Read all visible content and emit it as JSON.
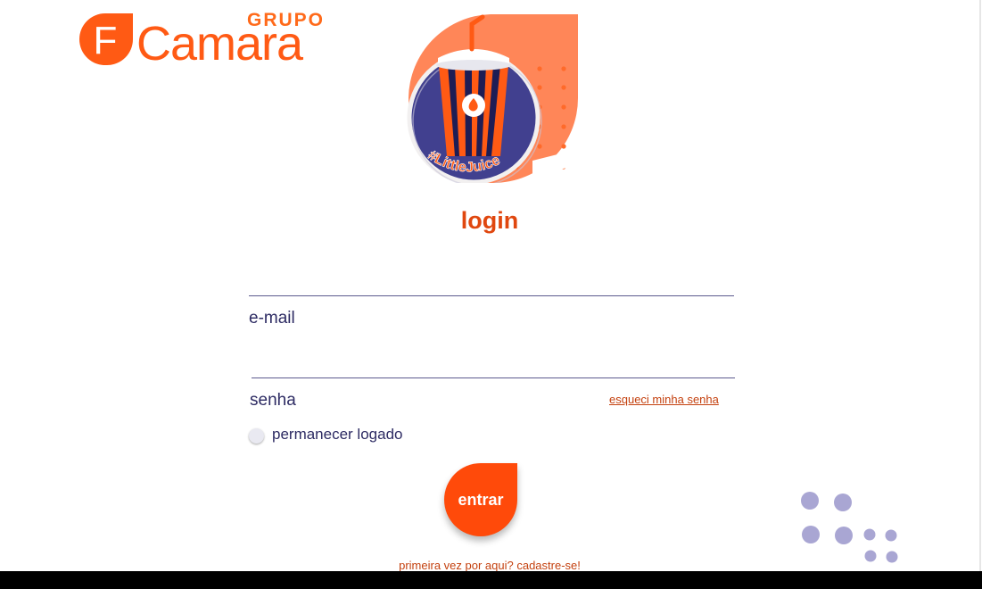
{
  "brand": {
    "group_label": "GRUPO",
    "name": "Camara",
    "mark_letter": "F",
    "color": "#ff5a14"
  },
  "hero": {
    "hashtag": "#LittleJuice",
    "icon": "juice-cup-illustration"
  },
  "login": {
    "title": "login",
    "email_label": "e-mail",
    "password_label": "senha",
    "forgot_password": "esqueci minha senha",
    "remember_me": "permanecer logado",
    "submit_label": "entrar",
    "signup_link": "primeira vez por aqui? cadastre-se!"
  },
  "colors": {
    "accent": "#ff4a0a",
    "link": "#c4410f",
    "text": "#2d2b63",
    "navy": "#41408f",
    "decor_dots": "#a9a6d3"
  }
}
